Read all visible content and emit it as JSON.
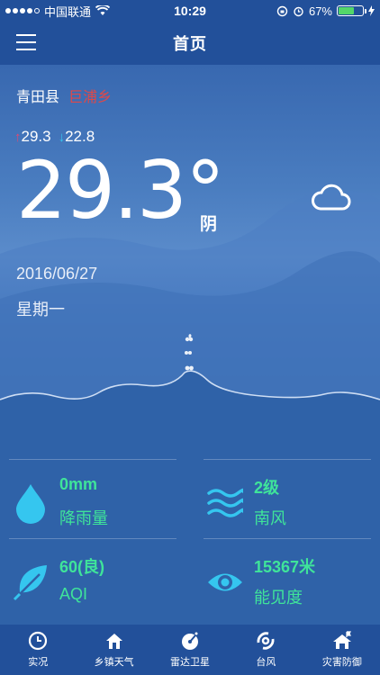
{
  "status_bar": {
    "carrier": "中国联通",
    "time": "10:29",
    "battery_percent": "67%",
    "battery_level": 0.67
  },
  "nav": {
    "title": "首页"
  },
  "hero": {
    "county": "青田县",
    "township": "巨浦乡",
    "high": "29.3",
    "low": "22.8",
    "temperature": "29.3°",
    "condition": "阴",
    "date": "2016/06/27",
    "weekday": "星期一"
  },
  "stats": {
    "rain": {
      "value": "0mm",
      "label": "降雨量",
      "icon": "raindrop-icon"
    },
    "wind": {
      "value": "2级",
      "label": "南风",
      "icon": "wind-icon"
    },
    "aqi": {
      "value": "60(良)",
      "label": "AQI",
      "icon": "leaf-icon"
    },
    "visibility": {
      "value": "15367米",
      "label": "能见度",
      "icon": "eye-icon"
    }
  },
  "tabs": [
    {
      "label": "实况",
      "icon": "clock-icon"
    },
    {
      "label": "乡镇天气",
      "icon": "house-icon"
    },
    {
      "label": "雷达卫星",
      "icon": "radar-icon"
    },
    {
      "label": "台风",
      "icon": "typhoon-icon"
    },
    {
      "label": "灾害防御",
      "icon": "shelter-icon"
    }
  ],
  "colors": {
    "accent_green": "#3fe49a",
    "accent_cyan": "#35c6ef",
    "bar_blue": "#22509a",
    "township_red": "#e04848"
  }
}
